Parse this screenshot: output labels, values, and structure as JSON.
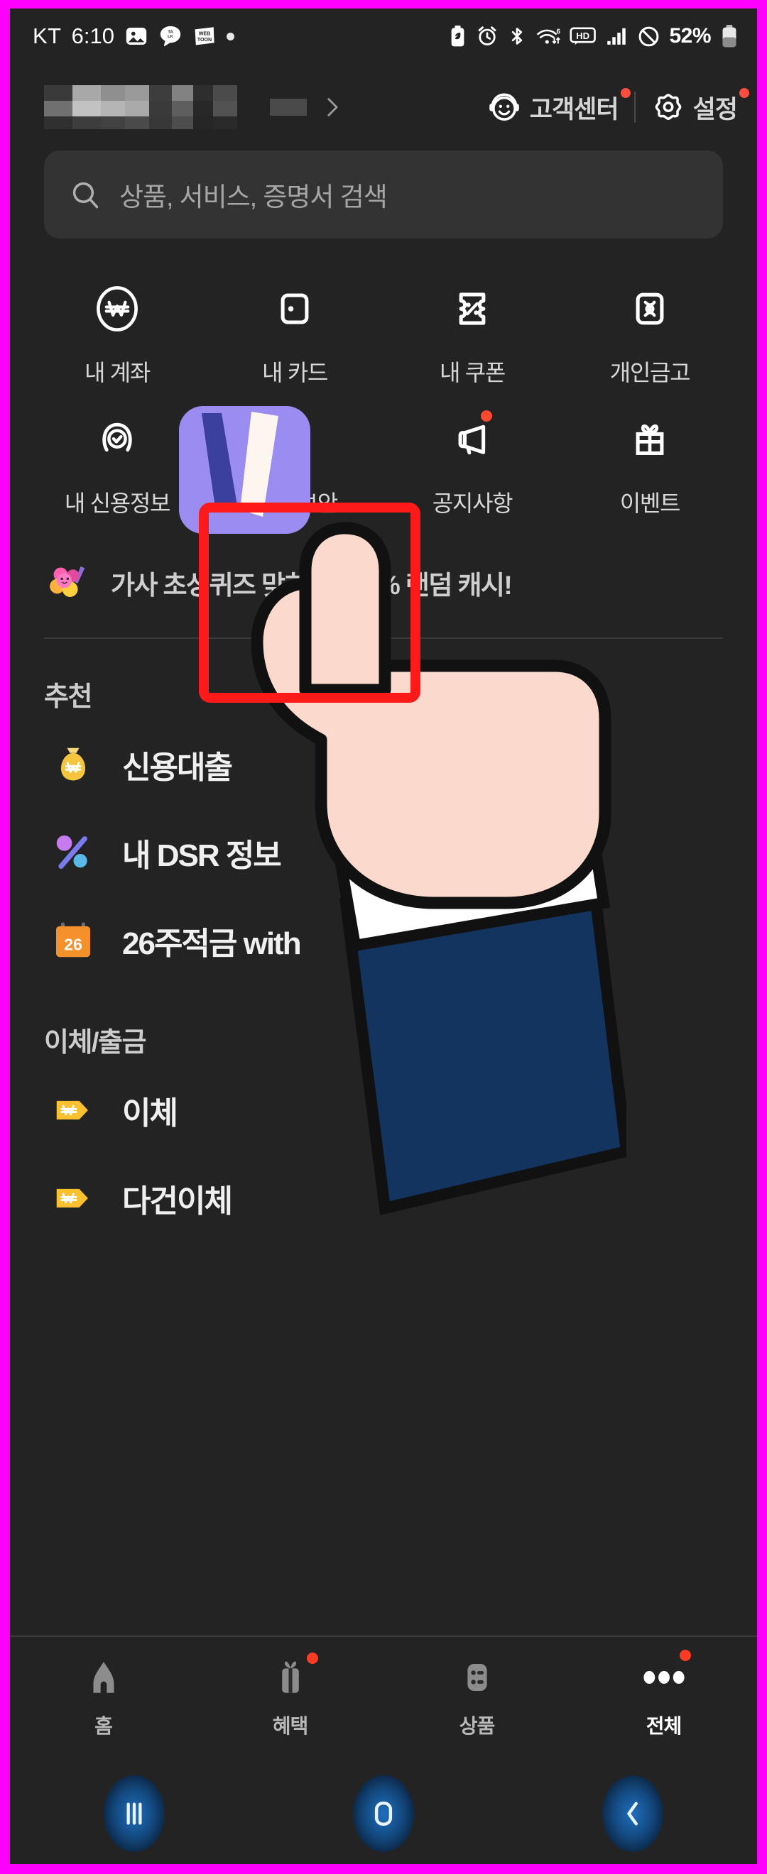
{
  "statusbar": {
    "carrier": "KT",
    "time": "6:10",
    "left_icons": [
      "photo-icon",
      "kakaotalk-icon",
      "webtoon-icon",
      "dot-icon"
    ],
    "right_icons": [
      "battery-saver-icon",
      "alarm-icon",
      "bluetooth-icon",
      "wifi-6-icon",
      "hd-icon",
      "signal-bars-icon",
      "do-not-disturb-icon"
    ],
    "battery_percent": "52%"
  },
  "header": {
    "profile_name_masked": "",
    "chevron": "chevron-right-icon",
    "customer_center": {
      "label": "고객센터",
      "icon": "headset-icon",
      "badge": true
    },
    "settings": {
      "label": "설정",
      "icon": "gear-icon",
      "badge": true
    }
  },
  "search": {
    "placeholder": "상품, 서비스, 증명서 검색",
    "icon": "search-icon"
  },
  "quick_menu": {
    "rows": [
      [
        {
          "label": "내 계좌",
          "icon": "won-circle-icon",
          "badge": false
        },
        {
          "label": "내 카드",
          "icon": "card-icon",
          "badge": false
        },
        {
          "label": "내 쿠폰",
          "icon": "coupon-percent-icon",
          "badge": false
        },
        {
          "label": "개인금고",
          "icon": "safe-box-icon",
          "badge": false
        }
      ],
      [
        {
          "label": "내 신용정보",
          "icon": "shield-check-icon",
          "badge": false
        },
        {
          "label": "인증/보안",
          "icon": "lock-icon",
          "badge": false
        },
        {
          "label": "공지사항",
          "icon": "megaphone-icon",
          "badge": true
        },
        {
          "label": "이벤트",
          "icon": "gift-icon",
          "badge": false
        }
      ]
    ]
  },
  "promo": {
    "text": "가사 초성퀴즈 맞히면 100% 랜덤 캐시!",
    "icon": "flower-icon"
  },
  "sections": [
    {
      "title": "추천",
      "items": [
        {
          "label": "신용대출",
          "icon": "money-bag-icon"
        },
        {
          "label": "내 DSR 정보",
          "icon": "percent-icon"
        },
        {
          "label": "26주적금 with",
          "icon": "calendar-26-icon"
        }
      ]
    },
    {
      "title": "이체/출금",
      "items": [
        {
          "label": "이체",
          "icon": "won-tag-icon"
        },
        {
          "label": "다건이체",
          "icon": "won-tag-icon"
        }
      ]
    }
  ],
  "bottom_nav": [
    {
      "label": "홈",
      "icon": "home-icon",
      "badge": false,
      "active": false
    },
    {
      "label": "혜택",
      "icon": "gift-box-icon",
      "badge": true,
      "active": false
    },
    {
      "label": "상품",
      "icon": "list-icon",
      "badge": false,
      "active": false
    },
    {
      "label": "전체",
      "icon": "more-dots-icon",
      "badge": true,
      "active": true
    }
  ],
  "android_nav": [
    {
      "label": "recents",
      "icon": "recents-icon"
    },
    {
      "label": "home",
      "icon": "home-square-icon"
    },
    {
      "label": "back",
      "icon": "back-chevron-icon"
    }
  ],
  "annotation": {
    "frame_color": "#FF00FF",
    "highlight_color": "#FF1A1A",
    "highlight_target": "인증/보안"
  }
}
